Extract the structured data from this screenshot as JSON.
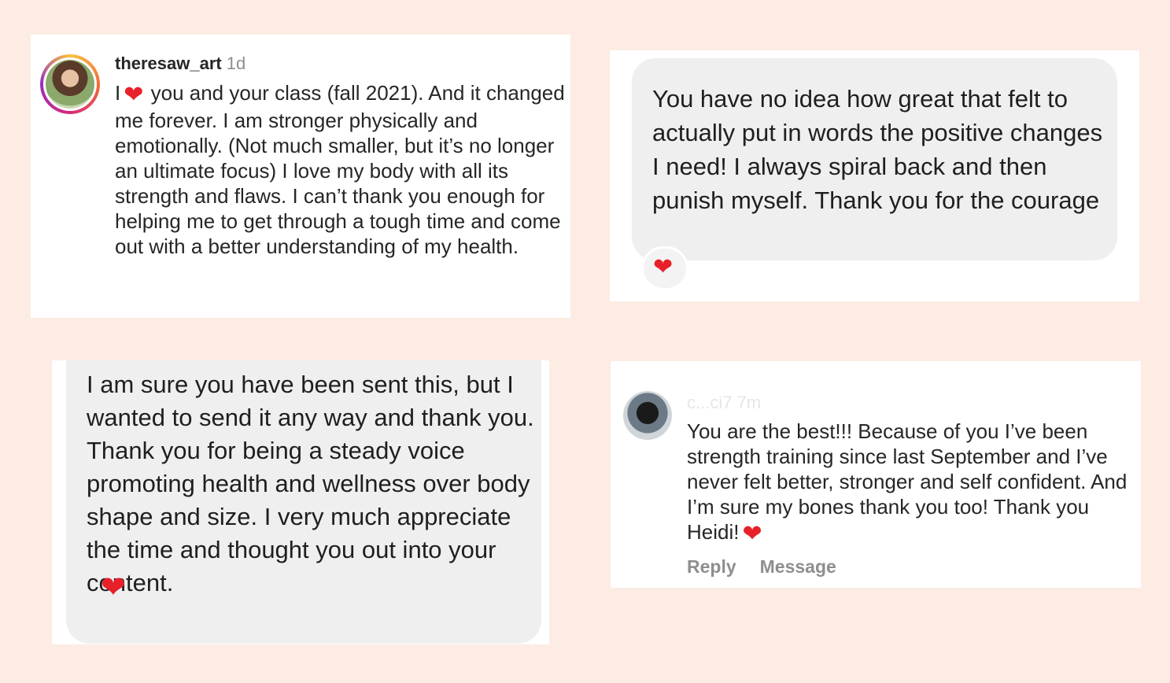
{
  "card1": {
    "username": "theresaw_art",
    "time": "1d",
    "text_before_heart": "I",
    "heart": "❤",
    "text_after_heart": "you and your class (fall 2021). And it changed me forever. I am stronger physically and emotionally. (Not much smaller, but it’s no longer an ultimate focus) I love my body with all its strength and flaws. I can’t thank you enough for helping me to get through a tough time and come out with a better understanding of my health."
  },
  "card2": {
    "message": "You have no idea how great that felt to actually put in words the positive changes I need! I always spiral back and then punish myself. Thank you for the courage",
    "reaction": "❤"
  },
  "card3": {
    "message": "I am sure you have been sent this, but I wanted to send it any way and thank you. Thank you for being a steady voice promoting health and wellness over body shape and size. I very much appreciate the time and thought you out into your content.",
    "heart": "❤"
  },
  "card4": {
    "username": "c...ci7 7m",
    "text": "You are the best!!! Because of you I’ve been strength training since last September and I’ve never felt better, stronger and self confident.  And I’m sure my bones thank you too!  Thank you Heidi!",
    "heart": "❤",
    "reply_label": "Reply",
    "message_label": "Message"
  },
  "colors": {
    "background": "#fcece4",
    "heart": "#e8202a",
    "bubble": "#efefef"
  }
}
